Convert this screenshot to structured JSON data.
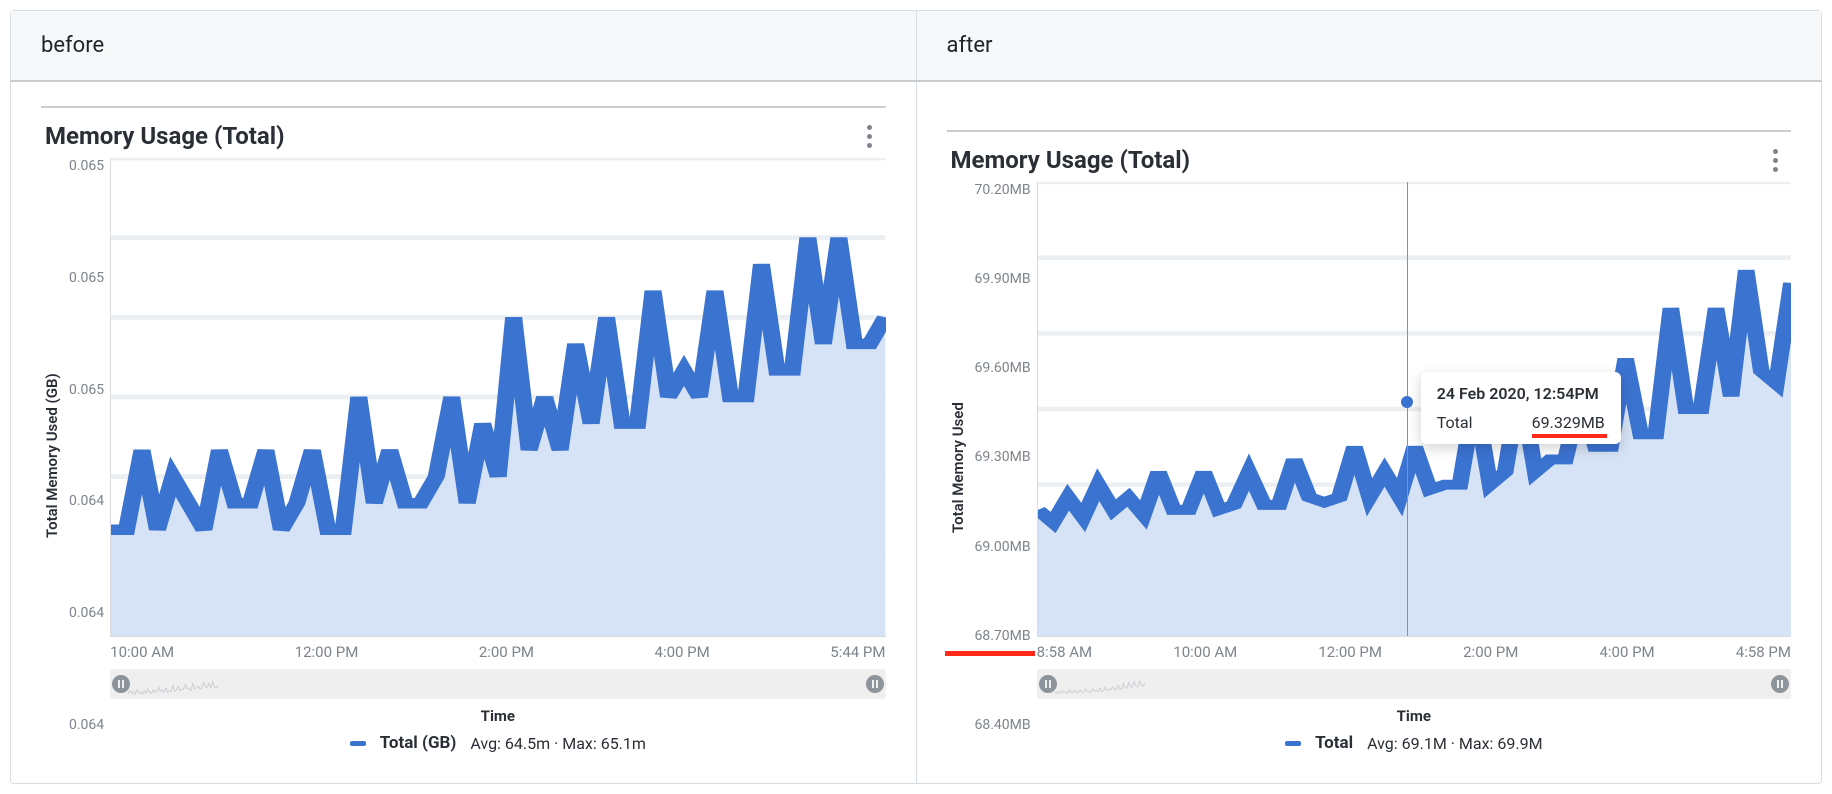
{
  "columns": {
    "before": "before",
    "after": "after"
  },
  "before": {
    "title": "Memory Usage (Total)",
    "ylabel": "Total Memory Used (GB)",
    "xlabel": "Time",
    "yticks": [
      "0.065",
      "0.065",
      "0.065",
      "0.064",
      "0.064",
      "0.064"
    ],
    "xticks": [
      "10:00 AM",
      "12:00 PM",
      "2:00 PM",
      "4:00 PM",
      "5:44 PM"
    ],
    "legend": {
      "name": "Total (GB)",
      "stats": "Avg: 64.5m · Max: 65.1m"
    }
  },
  "after": {
    "title": "Memory Usage (Total)",
    "ylabel": "Total Memory Used",
    "xlabel": "Time",
    "yticks": [
      "70.20MB",
      "69.90MB",
      "69.60MB",
      "69.30MB",
      "69.00MB",
      "68.70MB",
      "68.40MB"
    ],
    "xticks": [
      "8:58 AM",
      "10:00 AM",
      "12:00 PM",
      "2:00 PM",
      "4:00 PM",
      "4:58 PM"
    ],
    "legend": {
      "name": "Total",
      "stats": "Avg: 69.1M · Max: 69.9M"
    },
    "tooltip": {
      "title": "24 Feb 2020, 12:54PM",
      "label": "Total",
      "value": "69.329MB"
    }
  },
  "chart_data": [
    {
      "type": "area",
      "title": "Memory Usage (Total)",
      "xlabel": "Time",
      "ylabel": "Total Memory Used (GB)",
      "ylim": [
        0.0636,
        0.0654
      ],
      "x_range": [
        "10:00 AM",
        "5:44 PM"
      ],
      "series": [
        {
          "name": "Total (GB)",
          "summary": {
            "avg": 0.0645,
            "max": 0.0651
          },
          "x": [
            0,
            2,
            4,
            6,
            8,
            10,
            12,
            14,
            16,
            18,
            20,
            22,
            24,
            26,
            28,
            30,
            32,
            34,
            36,
            38,
            40,
            42,
            44,
            46,
            48,
            50,
            52,
            54,
            56,
            58,
            60,
            62,
            64,
            66,
            68,
            70,
            72,
            74,
            76,
            78,
            80,
            82,
            84,
            86,
            88,
            90,
            92,
            94,
            96,
            98,
            100
          ],
          "y": [
            0.064,
            0.064,
            0.0643,
            0.064,
            0.0642,
            0.0641,
            0.064,
            0.0643,
            0.0641,
            0.0641,
            0.0643,
            0.064,
            0.0641,
            0.0643,
            0.064,
            0.064,
            0.0645,
            0.0641,
            0.0643,
            0.0641,
            0.0641,
            0.0642,
            0.0645,
            0.0641,
            0.0644,
            0.0642,
            0.0648,
            0.0643,
            0.0645,
            0.0643,
            0.0647,
            0.0644,
            0.0648,
            0.0644,
            0.0644,
            0.0649,
            0.0645,
            0.0646,
            0.0645,
            0.0649,
            0.0645,
            0.0645,
            0.065,
            0.0646,
            0.0646,
            0.0651,
            0.0647,
            0.0651,
            0.0647,
            0.0647,
            0.0648
          ]
        }
      ]
    },
    {
      "type": "area",
      "title": "Memory Usage (Total)",
      "xlabel": "Time",
      "ylabel": "Total Memory Used",
      "ylim": [
        68.4,
        70.2
      ],
      "x_range": [
        "8:58 AM",
        "4:58 PM"
      ],
      "hover": {
        "time": "24 Feb 2020, 12:54PM",
        "value_mb": 69.329
      },
      "series": [
        {
          "name": "Total",
          "summary": {
            "avg": 69.1,
            "max": 69.9
          },
          "x": [
            0,
            2,
            4,
            6,
            8,
            10,
            12,
            14,
            16,
            18,
            20,
            22,
            24,
            26,
            28,
            30,
            32,
            34,
            36,
            38,
            40,
            42,
            44,
            46,
            48,
            50,
            52,
            54,
            56,
            58,
            60,
            62,
            64,
            66,
            68,
            70,
            72,
            74,
            76,
            78,
            80,
            82,
            84,
            86,
            88,
            90,
            92,
            94,
            96,
            98,
            100
          ],
          "y": [
            68.9,
            68.85,
            68.95,
            68.87,
            69.0,
            68.9,
            68.95,
            68.88,
            69.05,
            68.9,
            68.9,
            69.05,
            68.9,
            68.92,
            69.05,
            68.92,
            68.92,
            69.1,
            68.95,
            68.93,
            68.95,
            69.15,
            68.95,
            69.05,
            68.95,
            69.15,
            68.98,
            69.0,
            69.0,
            69.35,
            69.0,
            69.05,
            69.4,
            69.05,
            69.1,
            69.1,
            69.35,
            69.15,
            69.15,
            69.5,
            69.2,
            69.2,
            69.7,
            69.3,
            69.3,
            69.7,
            69.35,
            69.85,
            69.45,
            69.4,
            69.8
          ]
        }
      ]
    }
  ]
}
